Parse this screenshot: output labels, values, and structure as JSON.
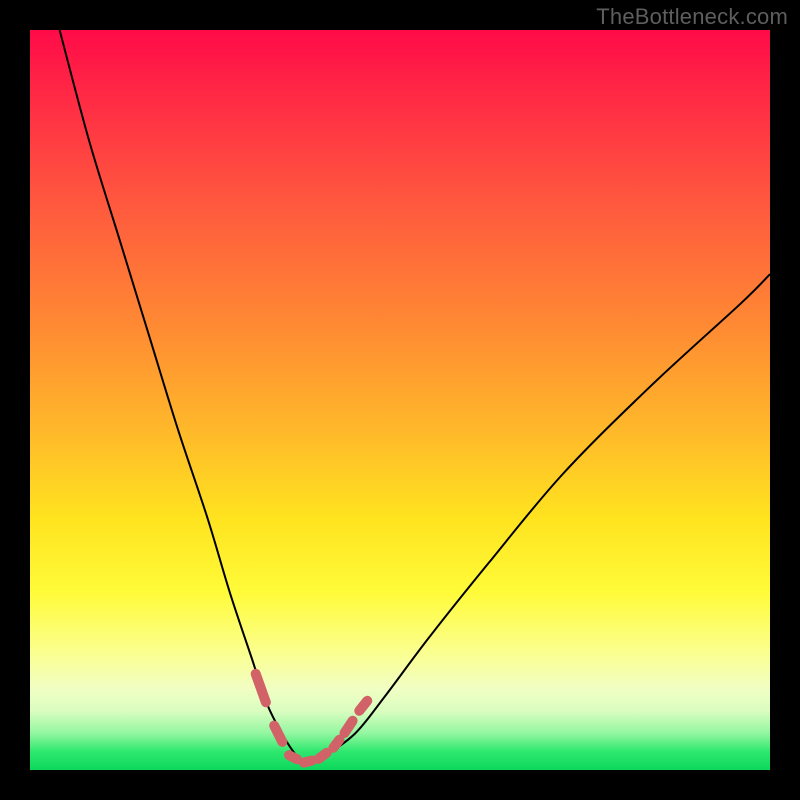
{
  "watermark": "TheBottleneck.com",
  "chart_data": {
    "type": "line",
    "title": "",
    "xlabel": "",
    "ylabel": "",
    "xlim": [
      0,
      100
    ],
    "ylim": [
      0,
      100
    ],
    "grid": false,
    "series": [
      {
        "name": "bottleneck-curve",
        "x": [
          4,
          8,
          12,
          16,
          20,
          24,
          27,
          30,
          32,
          34,
          36,
          38,
          40,
          44,
          48,
          54,
          62,
          72,
          84,
          96,
          100
        ],
        "y": [
          100,
          85,
          72,
          59,
          46,
          34,
          24,
          15,
          9,
          5,
          2,
          1,
          2,
          5,
          10,
          18,
          28,
          40,
          52,
          63,
          67
        ]
      }
    ],
    "highlight": {
      "name": "optimal-range-ticks",
      "color": "#d06268",
      "x": [
        30.5,
        33,
        35,
        37,
        39,
        41,
        42.5,
        44.5
      ],
      "y": [
        13,
        6,
        2,
        1,
        1.5,
        3,
        5,
        8
      ]
    },
    "background_gradient": [
      "#ff0b48",
      "#ffe31f",
      "#f1fec3",
      "#0cd85c"
    ]
  }
}
